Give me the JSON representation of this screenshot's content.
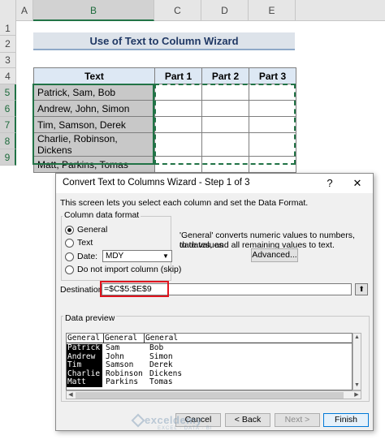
{
  "sheet": {
    "columns": [
      "A",
      "B",
      "C",
      "D",
      "E"
    ],
    "rows": [
      "1",
      "2",
      "3",
      "4",
      "5",
      "6",
      "7",
      "8",
      "9"
    ],
    "title": "Use of Text to Column Wizard",
    "table_headers": [
      "Text",
      "Part 1",
      "Part 2",
      "Part 3"
    ],
    "table_rows": [
      "Patrick, Sam, Bob",
      "Andrew, John, Simon",
      "Tim, Samson, Derek",
      "Charlie, Robinson, Dickens",
      "Matt, Parkins, Tomas"
    ],
    "colors": {
      "selection": "#217346",
      "title_text": "#203864",
      "header_fill": "#dde8f4"
    }
  },
  "dialog": {
    "title": "Convert Text to Columns Wizard - Step 1 of 3",
    "help_icon": "question-mark-icon",
    "close_icon": "close-icon",
    "intro": "This screen lets you select each column and set the Data Format.",
    "column_format_label": "Column data format",
    "options": {
      "general": "General",
      "text": "Text",
      "date": "Date:",
      "skip": "Do not import column (skip)"
    },
    "selected_option": "General",
    "date_format": "MDY",
    "description_line1": "'General' converts numeric values to numbers, date values",
    "description_line2": "to dates, and all remaining values to text.",
    "advanced_button": "Advanced...",
    "destination_label": "Destination:",
    "destination_value": "=$C$5:$E$9",
    "preview_label": "Data preview",
    "preview_headers": [
      "General",
      "General",
      "General"
    ],
    "preview_columns": [
      [
        "Patrick",
        "Andrew",
        "Tim",
        "Charlie",
        "Matt"
      ],
      [
        "Sam",
        "John",
        "Samson",
        "Robinson",
        "Parkins"
      ],
      [
        "Bob",
        "Simon",
        "Derek",
        "Dickens",
        "Tomas"
      ]
    ],
    "buttons": {
      "cancel": "Cancel",
      "back": "< Back",
      "next": "Next >",
      "finish": "Finish"
    }
  },
  "watermark": {
    "name": "exceldemy",
    "tagline": "EXCEL · DATA · BI"
  }
}
